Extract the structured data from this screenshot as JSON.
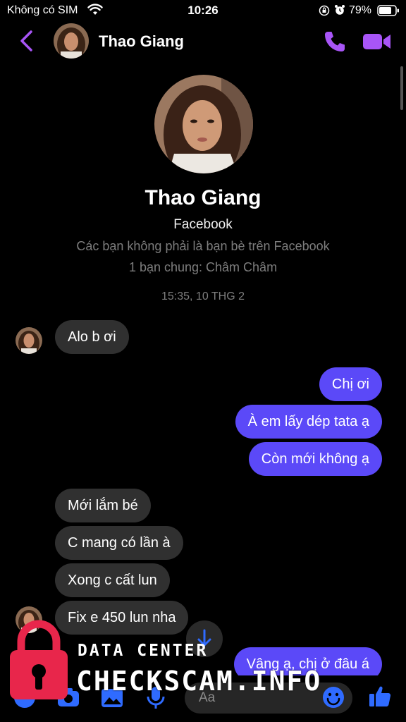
{
  "status_bar": {
    "carrier": "Không có SIM",
    "time": "10:26",
    "battery": "79%"
  },
  "header": {
    "contact_name": "Thao Giang"
  },
  "profile": {
    "name": "Thao Giang",
    "platform": "Facebook",
    "note": "Các bạn không phải là bạn bè trên Facebook",
    "mutual": "1 bạn chung: Châm Châm"
  },
  "timestamp": "15:35, 10 THG 2",
  "messages": [
    {
      "dir": "in",
      "text": "Alo b ơi"
    },
    {
      "dir": "out",
      "text": "Chị ơi"
    },
    {
      "dir": "out",
      "text": "À em lấy dép tata ạ"
    },
    {
      "dir": "out",
      "text": "Còn mới không ạ"
    },
    {
      "dir": "in",
      "text": "Mới lắm bé"
    },
    {
      "dir": "in",
      "text": "C mang có lần à"
    },
    {
      "dir": "in",
      "text": "Xong c cất lun"
    },
    {
      "dir": "in",
      "text": "Fix e 450 lun nha"
    },
    {
      "dir": "out",
      "text": "Vâng ạ, chị ở đâu á"
    }
  ],
  "composer": {
    "placeholder": "Aa"
  },
  "watermark": {
    "title": "DATA CENTER",
    "brand": "CHECKSCAM.INFO"
  },
  "colors": {
    "accent": "#a855f7",
    "outgoing_bubble": "#5b49f8",
    "incoming_bubble": "#303030",
    "composer_icons": "#2f6bff",
    "watermark_lock": "#e8264b"
  },
  "icons": {
    "back": "chevron-left-icon",
    "call": "phone-icon",
    "video": "video-camera-icon",
    "camera": "camera-icon",
    "gallery": "image-icon",
    "mic": "microphone-icon",
    "emoji": "smiley-icon",
    "like": "thumbs-up-icon",
    "scroll_down": "arrow-down-icon"
  }
}
